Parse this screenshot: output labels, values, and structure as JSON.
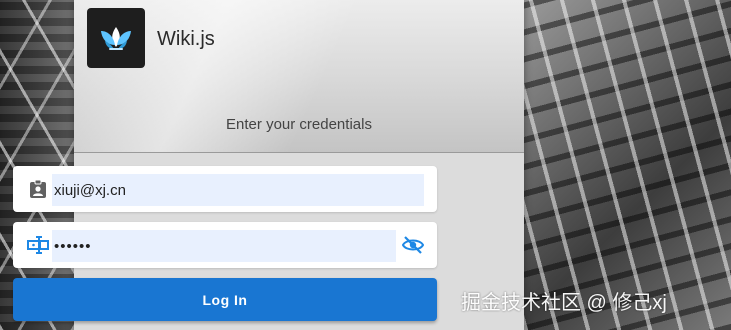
{
  "app": {
    "name": "Wiki.js",
    "logo_icon": "wikijs-logo-icon"
  },
  "login": {
    "subtitle": "Enter your credentials",
    "email": {
      "icon": "id-badge-icon",
      "value": "xiuji@xj.cn"
    },
    "password": {
      "icon": "password-field-icon",
      "value": "••••••",
      "visibility_icon": "eye-off-icon"
    },
    "button_label": "Log In"
  },
  "watermark": "掘金技术社区 @ 修己xj",
  "colors": {
    "accent": "#1976d2",
    "icon_blue": "#1e88e5",
    "autofill": "#e8f0fe"
  }
}
